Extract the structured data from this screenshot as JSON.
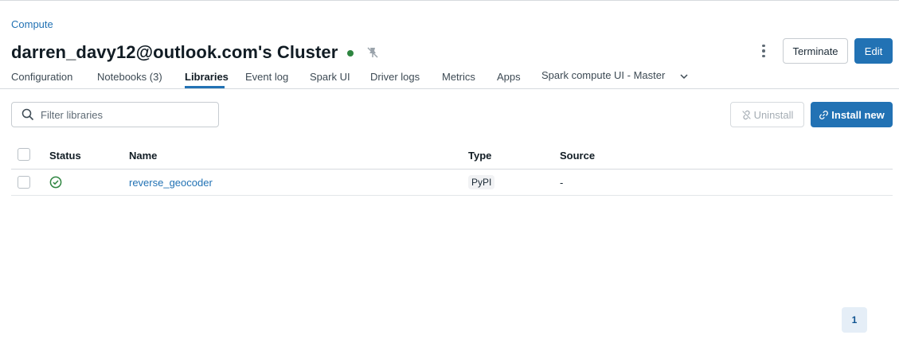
{
  "breadcrumb": "Compute",
  "cluster": {
    "title": "darren_davy12@outlook.com's Cluster",
    "status_color": "#2e8540"
  },
  "actions": {
    "terminate_label": "Terminate",
    "edit_label": "Edit"
  },
  "tabs": [
    {
      "label": "Configuration"
    },
    {
      "label": "Notebooks (3)"
    },
    {
      "label": "Libraries",
      "active": true
    },
    {
      "label": "Event log"
    },
    {
      "label": "Spark UI"
    },
    {
      "label": "Driver logs"
    },
    {
      "label": "Metrics"
    },
    {
      "label": "Apps"
    },
    {
      "label": "Spark compute UI - Master"
    }
  ],
  "toolbar": {
    "search_placeholder": "Filter libraries",
    "uninstall_label": "Uninstall",
    "install_label": "Install new"
  },
  "table": {
    "columns": [
      "Status",
      "Name",
      "Type",
      "Source"
    ],
    "rows": [
      {
        "status": "installed",
        "name": "reverse_geocoder",
        "type": "PyPI",
        "source": "-"
      }
    ]
  },
  "pagination": {
    "current_page": "1"
  },
  "colors": {
    "accent": "#2272b4",
    "success": "#2e8540"
  },
  "icons": {
    "status": "check-circle-icon",
    "pin": "pin-off-icon",
    "menu": "kebab-menu-icon",
    "search": "search-icon",
    "uninstall": "unlink-icon",
    "install": "link-icon",
    "more_tabs": "chevron-down-icon"
  }
}
